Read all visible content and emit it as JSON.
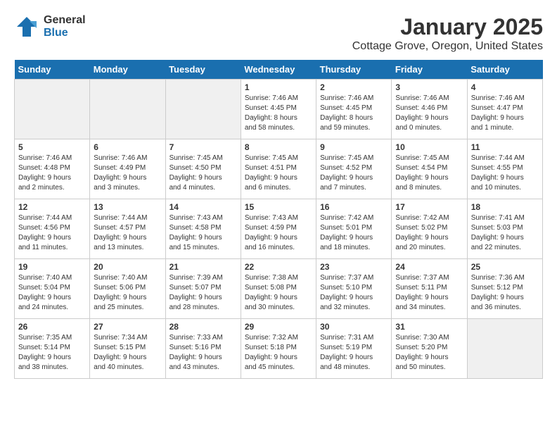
{
  "header": {
    "logo_general": "General",
    "logo_blue": "Blue",
    "month": "January 2025",
    "location": "Cottage Grove, Oregon, United States"
  },
  "weekdays": [
    "Sunday",
    "Monday",
    "Tuesday",
    "Wednesday",
    "Thursday",
    "Friday",
    "Saturday"
  ],
  "weeks": [
    [
      {
        "day": "",
        "info": "",
        "empty": true
      },
      {
        "day": "",
        "info": "",
        "empty": true
      },
      {
        "day": "",
        "info": "",
        "empty": true
      },
      {
        "day": "1",
        "info": "Sunrise: 7:46 AM\nSunset: 4:45 PM\nDaylight: 8 hours\nand 58 minutes.",
        "empty": false
      },
      {
        "day": "2",
        "info": "Sunrise: 7:46 AM\nSunset: 4:45 PM\nDaylight: 8 hours\nand 59 minutes.",
        "empty": false
      },
      {
        "day": "3",
        "info": "Sunrise: 7:46 AM\nSunset: 4:46 PM\nDaylight: 9 hours\nand 0 minutes.",
        "empty": false
      },
      {
        "day": "4",
        "info": "Sunrise: 7:46 AM\nSunset: 4:47 PM\nDaylight: 9 hours\nand 1 minute.",
        "empty": false
      }
    ],
    [
      {
        "day": "5",
        "info": "Sunrise: 7:46 AM\nSunset: 4:48 PM\nDaylight: 9 hours\nand 2 minutes.",
        "empty": false
      },
      {
        "day": "6",
        "info": "Sunrise: 7:46 AM\nSunset: 4:49 PM\nDaylight: 9 hours\nand 3 minutes.",
        "empty": false
      },
      {
        "day": "7",
        "info": "Sunrise: 7:45 AM\nSunset: 4:50 PM\nDaylight: 9 hours\nand 4 minutes.",
        "empty": false
      },
      {
        "day": "8",
        "info": "Sunrise: 7:45 AM\nSunset: 4:51 PM\nDaylight: 9 hours\nand 6 minutes.",
        "empty": false
      },
      {
        "day": "9",
        "info": "Sunrise: 7:45 AM\nSunset: 4:52 PM\nDaylight: 9 hours\nand 7 minutes.",
        "empty": false
      },
      {
        "day": "10",
        "info": "Sunrise: 7:45 AM\nSunset: 4:54 PM\nDaylight: 9 hours\nand 8 minutes.",
        "empty": false
      },
      {
        "day": "11",
        "info": "Sunrise: 7:44 AM\nSunset: 4:55 PM\nDaylight: 9 hours\nand 10 minutes.",
        "empty": false
      }
    ],
    [
      {
        "day": "12",
        "info": "Sunrise: 7:44 AM\nSunset: 4:56 PM\nDaylight: 9 hours\nand 11 minutes.",
        "empty": false
      },
      {
        "day": "13",
        "info": "Sunrise: 7:44 AM\nSunset: 4:57 PM\nDaylight: 9 hours\nand 13 minutes.",
        "empty": false
      },
      {
        "day": "14",
        "info": "Sunrise: 7:43 AM\nSunset: 4:58 PM\nDaylight: 9 hours\nand 15 minutes.",
        "empty": false
      },
      {
        "day": "15",
        "info": "Sunrise: 7:43 AM\nSunset: 4:59 PM\nDaylight: 9 hours\nand 16 minutes.",
        "empty": false
      },
      {
        "day": "16",
        "info": "Sunrise: 7:42 AM\nSunset: 5:01 PM\nDaylight: 9 hours\nand 18 minutes.",
        "empty": false
      },
      {
        "day": "17",
        "info": "Sunrise: 7:42 AM\nSunset: 5:02 PM\nDaylight: 9 hours\nand 20 minutes.",
        "empty": false
      },
      {
        "day": "18",
        "info": "Sunrise: 7:41 AM\nSunset: 5:03 PM\nDaylight: 9 hours\nand 22 minutes.",
        "empty": false
      }
    ],
    [
      {
        "day": "19",
        "info": "Sunrise: 7:40 AM\nSunset: 5:04 PM\nDaylight: 9 hours\nand 24 minutes.",
        "empty": false
      },
      {
        "day": "20",
        "info": "Sunrise: 7:40 AM\nSunset: 5:06 PM\nDaylight: 9 hours\nand 25 minutes.",
        "empty": false
      },
      {
        "day": "21",
        "info": "Sunrise: 7:39 AM\nSunset: 5:07 PM\nDaylight: 9 hours\nand 28 minutes.",
        "empty": false
      },
      {
        "day": "22",
        "info": "Sunrise: 7:38 AM\nSunset: 5:08 PM\nDaylight: 9 hours\nand 30 minutes.",
        "empty": false
      },
      {
        "day": "23",
        "info": "Sunrise: 7:37 AM\nSunset: 5:10 PM\nDaylight: 9 hours\nand 32 minutes.",
        "empty": false
      },
      {
        "day": "24",
        "info": "Sunrise: 7:37 AM\nSunset: 5:11 PM\nDaylight: 9 hours\nand 34 minutes.",
        "empty": false
      },
      {
        "day": "25",
        "info": "Sunrise: 7:36 AM\nSunset: 5:12 PM\nDaylight: 9 hours\nand 36 minutes.",
        "empty": false
      }
    ],
    [
      {
        "day": "26",
        "info": "Sunrise: 7:35 AM\nSunset: 5:14 PM\nDaylight: 9 hours\nand 38 minutes.",
        "empty": false
      },
      {
        "day": "27",
        "info": "Sunrise: 7:34 AM\nSunset: 5:15 PM\nDaylight: 9 hours\nand 40 minutes.",
        "empty": false
      },
      {
        "day": "28",
        "info": "Sunrise: 7:33 AM\nSunset: 5:16 PM\nDaylight: 9 hours\nand 43 minutes.",
        "empty": false
      },
      {
        "day": "29",
        "info": "Sunrise: 7:32 AM\nSunset: 5:18 PM\nDaylight: 9 hours\nand 45 minutes.",
        "empty": false
      },
      {
        "day": "30",
        "info": "Sunrise: 7:31 AM\nSunset: 5:19 PM\nDaylight: 9 hours\nand 48 minutes.",
        "empty": false
      },
      {
        "day": "31",
        "info": "Sunrise: 7:30 AM\nSunset: 5:20 PM\nDaylight: 9 hours\nand 50 minutes.",
        "empty": false
      },
      {
        "day": "",
        "info": "",
        "empty": true
      }
    ]
  ]
}
